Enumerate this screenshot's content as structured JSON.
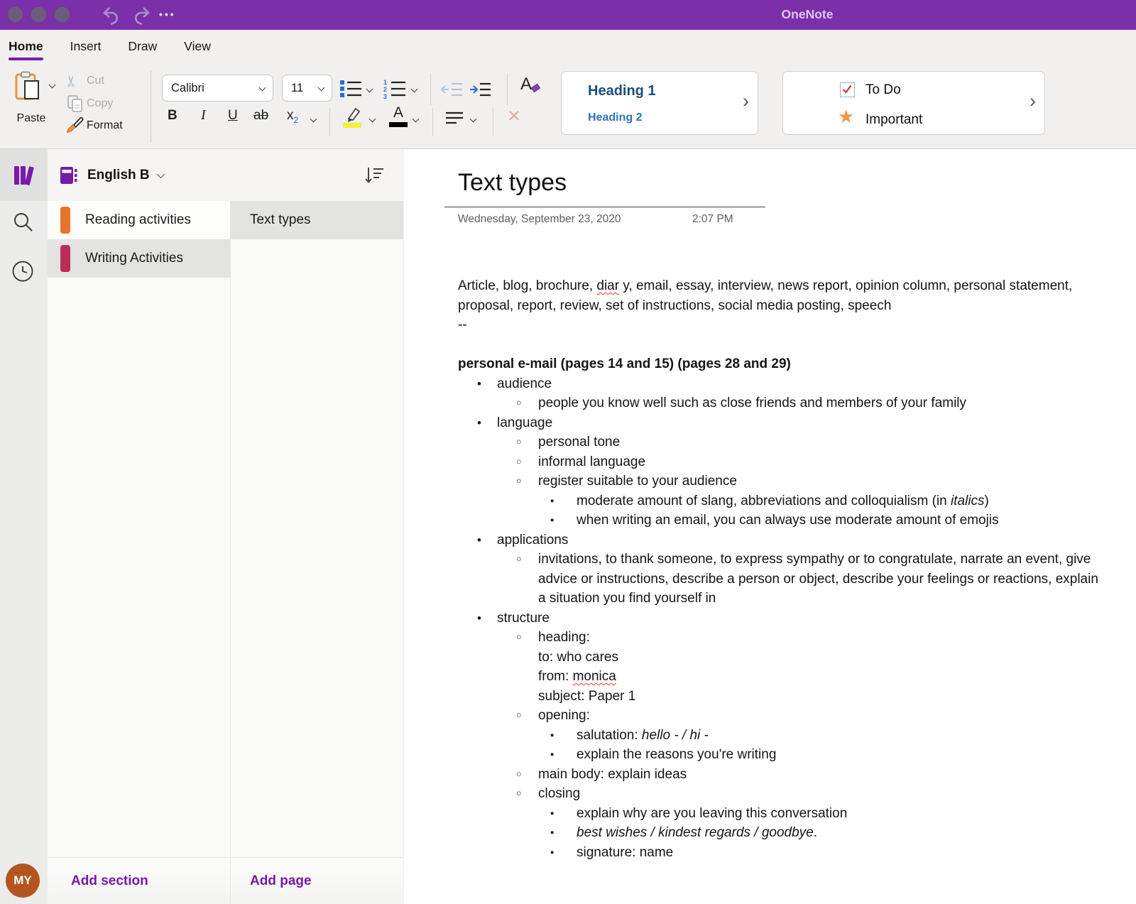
{
  "titlebar": {
    "app_title": "OneNote",
    "window_controls": [
      "close",
      "minimize",
      "zoom"
    ]
  },
  "ribbon": {
    "tabs": [
      {
        "label": "Home",
        "active": true
      },
      {
        "label": "Insert",
        "active": false
      },
      {
        "label": "Draw",
        "active": false
      },
      {
        "label": "View",
        "active": false
      }
    ],
    "clipboard": {
      "paste_label": "Paste",
      "cut_label": "Cut",
      "copy_label": "Copy",
      "format_label": "Format"
    },
    "font": {
      "family": "Calibri",
      "size": "11",
      "bold": "B",
      "italic": "I",
      "underline": "U",
      "strikethrough": "ab",
      "subscript_base": "x",
      "subscript_sub": "2"
    },
    "styles": {
      "heading1_label": "Heading 1",
      "heading2_label": "Heading 2"
    },
    "tags": {
      "todo_label": "To Do",
      "important_label": "Important"
    }
  },
  "sidebar": {
    "notebook_name": "English B",
    "sections": [
      {
        "label": "Reading activities",
        "color": "#e8732a",
        "selected": false
      },
      {
        "label": "Writing Activities",
        "color": "#b92d56",
        "selected": true
      }
    ],
    "pages": [
      {
        "label": "Text types",
        "selected": true
      }
    ],
    "add_section_label": "Add section",
    "add_page_label": "Add page",
    "avatar_initials": "MY"
  },
  "page": {
    "title": "Text types",
    "date": "Wednesday, September 23, 2020",
    "time": "2:07 PM",
    "intro_runs": [
      {
        "t": "Article, blog, brochure, "
      },
      {
        "t": "diar",
        "m": true
      },
      {
        "t": " y, email, essay, interview, news report, opinion column, personal statement, proposal, report, review, set of instructions, social media posting, speech"
      }
    ],
    "separator": "--",
    "section_heading": "personal e-mail (pages 14 and 15) (pages 28 and 29)",
    "markers": {
      "1": "•",
      "2": "○",
      "3": "▪"
    },
    "list": [
      {
        "level": 1,
        "runs": [
          {
            "t": "audience"
          }
        ]
      },
      {
        "level": 2,
        "runs": [
          {
            "t": "people you know well such as close friends and members of your family"
          }
        ]
      },
      {
        "level": 1,
        "runs": [
          {
            "t": "language"
          }
        ]
      },
      {
        "level": 2,
        "runs": [
          {
            "t": "personal tone"
          }
        ]
      },
      {
        "level": 2,
        "runs": [
          {
            "t": "informal language"
          }
        ]
      },
      {
        "level": 2,
        "runs": [
          {
            "t": "register suitable to your audience"
          }
        ]
      },
      {
        "level": 3,
        "runs": [
          {
            "t": "moderate amount of slang, abbreviations and colloquialism (in "
          },
          {
            "t": "italics",
            "i": true
          },
          {
            "t": ")"
          }
        ]
      },
      {
        "level": 3,
        "runs": [
          {
            "t": "when writing an email, you can always use moderate amount of emojis"
          }
        ]
      },
      {
        "level": 1,
        "runs": [
          {
            "t": "applications"
          }
        ]
      },
      {
        "level": 2,
        "runs": [
          {
            "t": "invitations, to thank someone, to express sympathy or to congratulate, narrate an event, give advice or instructions, describe a person or object, describe your feelings or reactions, explain a situation you find yourself in"
          }
        ]
      },
      {
        "level": 1,
        "runs": [
          {
            "t": "structure"
          }
        ]
      },
      {
        "level": 2,
        "runs": [
          {
            "t": "heading:"
          }
        ]
      },
      {
        "level": 2,
        "no_marker": true,
        "runs": [
          {
            "t": "to: who cares"
          }
        ]
      },
      {
        "level": 2,
        "no_marker": true,
        "runs": [
          {
            "t": "from: "
          },
          {
            "t": "monica",
            "m": true
          }
        ]
      },
      {
        "level": 2,
        "no_marker": true,
        "runs": [
          {
            "t": "subject: Paper 1"
          }
        ]
      },
      {
        "level": 2,
        "runs": [
          {
            "t": "opening:"
          }
        ]
      },
      {
        "level": 3,
        "runs": [
          {
            "t": "salutation: "
          },
          {
            "t": "hello - / hi -",
            "i": true
          }
        ]
      },
      {
        "level": 3,
        "runs": [
          {
            "t": "explain the reasons you're writing"
          }
        ]
      },
      {
        "level": 2,
        "runs": [
          {
            "t": "main body: explain ideas"
          }
        ]
      },
      {
        "level": 2,
        "runs": [
          {
            "t": "closing"
          }
        ]
      },
      {
        "level": 3,
        "runs": [
          {
            "t": "explain why are you leaving this conversation"
          }
        ]
      },
      {
        "level": 3,
        "runs": [
          {
            "t": "best wishes  / kindest regards / goodbye",
            "i": true
          },
          {
            "t": "."
          }
        ]
      },
      {
        "level": 3,
        "runs": [
          {
            "t": "signature: name"
          }
        ]
      }
    ]
  },
  "colors": {
    "titlebar_purple": "#7b2fa9",
    "accent_purple": "#7719aa",
    "heading1_blue": "#1f4e79",
    "heading2_blue": "#2e74b5",
    "star_orange": "#e8994a",
    "check_red": "#c2342c",
    "highlight_yellow": "#f3ef39",
    "section_orange": "#e8732a",
    "section_maroon": "#b92d56",
    "avatar_rust": "#b4551f"
  },
  "icons": {
    "undo": "curved-arrow-left",
    "redo": "curved-arrow-right",
    "ellipsis": "•••",
    "paste": "clipboard",
    "cut": "scissors",
    "copy": "pages",
    "format": "paintbrush",
    "bullets": "bullet-list",
    "numbering": "numbered-list",
    "outdent": "arrow-left-lines",
    "indent": "arrow-right-lines",
    "clear_formatting": "A-eraser",
    "highlighter": "pen-yellow-bar",
    "font_color": "A-black-bar",
    "align": "align-lines",
    "delete": "×",
    "panel_arrow": "›",
    "notebooks": "book-stack",
    "search": "magnifier",
    "recent": "clock",
    "notebook": "purple-book",
    "sort": "sort-descending",
    "todo": "checked-box",
    "important": "★"
  }
}
